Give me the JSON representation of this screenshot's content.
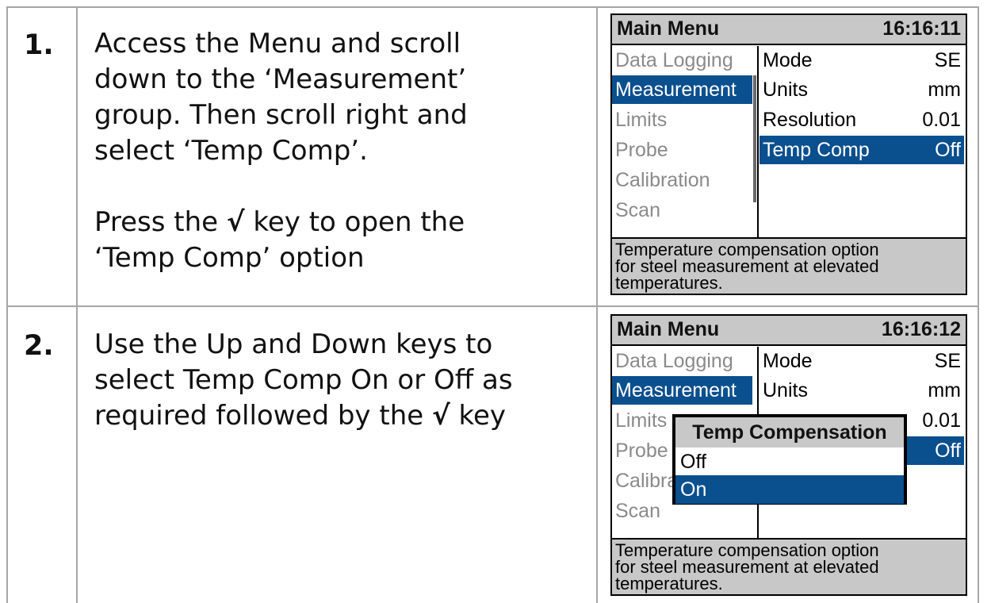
{
  "steps": [
    {
      "number": "1.",
      "paragraphs": [
        [
          "Access the Menu and scroll",
          "down to the ‘Measurement’",
          "group. Then scroll right and",
          "select ‘Temp Comp’."
        ],
        [
          "Press the ",
          "√",
          " key to open the",
          "‘Temp Comp’ option"
        ]
      ],
      "screen": {
        "title": "Main Menu",
        "time": "16:16:11",
        "menu": [
          "Data Logging",
          "Measurement",
          "Limits",
          "Probe",
          "Calibration",
          "Scan"
        ],
        "menu_selected_index": 1,
        "options": [
          {
            "label": "Mode",
            "value": "SE"
          },
          {
            "label": "Units",
            "value": "mm"
          },
          {
            "label": "Resolution",
            "value": "0.01"
          },
          {
            "label": "Temp Comp",
            "value": "Off"
          }
        ],
        "option_selected_index": 3,
        "help": [
          "Temperature compensation option",
          "for steel measurement at elevated",
          "temperatures."
        ]
      }
    },
    {
      "number": "2.",
      "lines": [
        "Use the Up and Down keys to",
        "select Temp Comp On or Off as",
        "required followed by the ",
        "√",
        " key"
      ],
      "screen": {
        "title": "Main Menu",
        "time": "16:16:12",
        "menu": [
          "Data Logging",
          "Measurement",
          "Limits",
          "Probe",
          "Calibra",
          "Scan"
        ],
        "menu_selected_index": 1,
        "options": [
          {
            "label": "Mode",
            "value": "SE"
          },
          {
            "label": "Units",
            "value": "mm"
          },
          {
            "label": "",
            "value": "0.01"
          },
          {
            "label": "",
            "value": "Off"
          }
        ],
        "option_selected_index": 3,
        "popup": {
          "title": "Temp Compensation",
          "options": [
            "Off",
            "On"
          ],
          "selected_index": 1
        },
        "help": [
          "Temperature compensation option",
          "for steel measurement at elevated",
          "temperatures."
        ]
      }
    }
  ],
  "colors": {
    "selection": "#0a4f8e",
    "bar_gray": "#c8c8c8",
    "disabled_text": "#8a8a8a",
    "table_border": "#a6a6a6"
  }
}
